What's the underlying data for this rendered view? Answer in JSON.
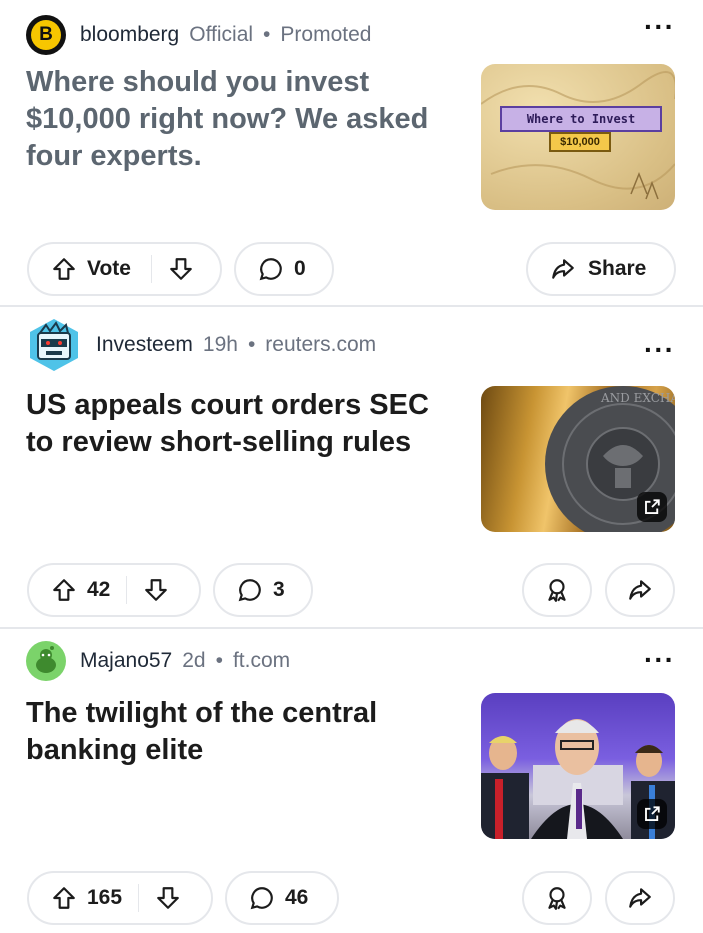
{
  "posts": [
    {
      "author": "bloomberg",
      "badge_letter": "B",
      "flair": "Official",
      "tag": "Promoted",
      "title": "Where should you invest $10,000 right now? We asked four experts.",
      "thumb_title": "Where to Invest",
      "thumb_amount": "$10,000",
      "vote_label": "Vote",
      "comments": "0",
      "share_label": "Share"
    },
    {
      "author": "Investeem",
      "age": "19h",
      "domain": "reuters.com",
      "title": "US appeals court orders SEC to review short-selling rules",
      "seal_text": "AND EXCHANGE",
      "votes": "42",
      "comments": "3"
    },
    {
      "author": "Majano57",
      "age": "2d",
      "domain": "ft.com",
      "title": "The twilight of the central banking elite",
      "votes": "165",
      "comments": "46"
    }
  ],
  "colors": {
    "badge_yellow": "#f7c600",
    "promo_title": "#5c6670",
    "divider": "#e5e7eb"
  },
  "icons": [
    "upvote-icon",
    "downvote-icon",
    "comment-icon",
    "share-icon",
    "award-icon",
    "more-icon",
    "external-link-icon"
  ]
}
